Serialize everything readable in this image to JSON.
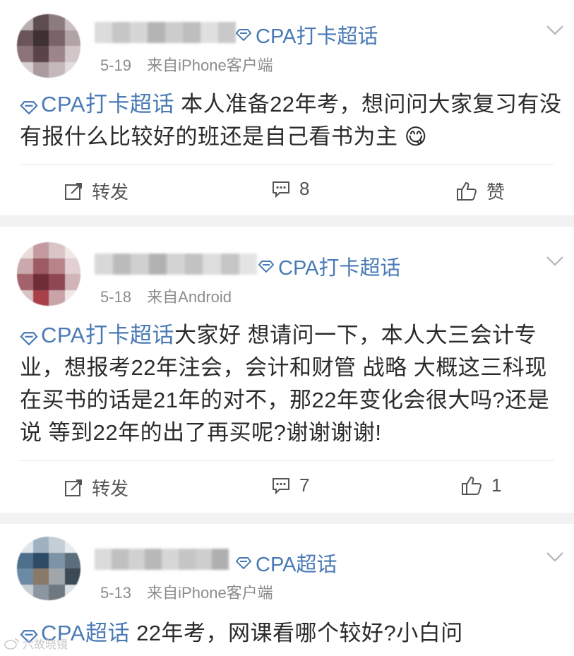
{
  "posts": [
    {
      "topic_tag": "CPA打卡超话",
      "date": "5-19",
      "source": "来自iPhone客户端",
      "body_tag": "CPA打卡超话",
      "body": " 本人准备22年考，想问问大家复习有没有报什么比较好的班还是自己看书为主 ",
      "emoji": "😋",
      "repost_label": "转发",
      "comment_count": "8",
      "like_label": "赞"
    },
    {
      "topic_tag": "CPA打卡超话",
      "date": "5-18",
      "source": "来自Android",
      "body_tag": "CPA打卡超话",
      "body": "大家好 想请问一下，本人大三会计专业，想报考22年注会，会计和财管 战略 大概这三科现在买书的话是21年的对不，那22年变化会很大吗?还是说 等到22年的出了再买呢?谢谢谢谢!",
      "repost_label": "转发",
      "comment_count": "7",
      "like_label": "1"
    },
    {
      "topic_tag": "CPA超话",
      "date": "5-13",
      "source": "来自iPhone客户端",
      "body_tag": "CPA超话",
      "body": " 22年考，网课看哪个较好?小白问"
    }
  ],
  "watermark": "六故晓镜",
  "colors": {
    "link": "#4a7ab5",
    "meta": "#8c8c8c",
    "background": "#f2f2f2"
  },
  "icons": {
    "topic": "diamond-icon",
    "repost": "repost-icon",
    "comment": "comment-icon",
    "like": "thumbs-up-icon",
    "menu": "chevron-down-icon"
  }
}
